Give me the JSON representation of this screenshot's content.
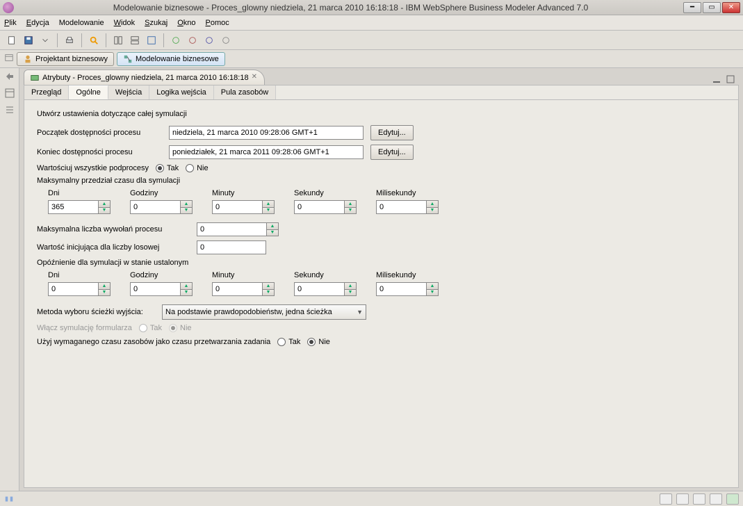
{
  "window": {
    "title": "Modelowanie biznesowe - Proces_glowny niedziela, 21 marca 2010 16:18:18 - IBM WebSphere Business Modeler Advanced 7.0"
  },
  "menu": {
    "file": "Plik",
    "edit": "Edycja",
    "modeling": "Modelowanie",
    "view": "Widok",
    "find": "Szukaj",
    "window": "Okno",
    "help": "Pomoc"
  },
  "perspectives": {
    "designer": "Projektant biznesowy",
    "modeling": "Modelowanie biznesowe"
  },
  "editor": {
    "tab_title": "Atrybuty - Proces_glowny niedziela, 21 marca 2010 16:18:18"
  },
  "subtabs": {
    "overview": "Przegląd",
    "general": "Ogólne",
    "inputs": "Wejścia",
    "inputlogic": "Logika wejścia",
    "resourcepool": "Pula zasobów"
  },
  "form": {
    "section_title": "Utwórz ustawienia dotyczące całej symulacji",
    "start_label": "Początek dostępności procesu",
    "start_value": "niedziela, 21 marca 2010 09:28:06 GMT+1",
    "end_label": "Koniec dostępności procesu",
    "end_value": "poniedziałek, 21 marca 2011 09:28:06 GMT+1",
    "edit_btn": "Edytuj...",
    "value_subprocesses": "Wartościuj wszystkie podprocesy",
    "yes": "Tak",
    "no": "Nie",
    "max_interval": "Maksymalny przedział czasu dla symulacji",
    "days": "Dni",
    "hours": "Godziny",
    "minutes": "Minuty",
    "seconds": "Sekundy",
    "ms": "Milisekundy",
    "interval1": {
      "d": "365",
      "h": "0",
      "m": "0",
      "s": "0",
      "ms": "0"
    },
    "max_calls": "Maksymalna liczba wywołań procesu",
    "max_calls_value": "0",
    "seed_label": "Wartość inicjująca dla liczby losowej",
    "seed_value": "0",
    "delay_label": "Opóźnienie dla symulacji w stanie ustalonym",
    "interval2": {
      "d": "0",
      "h": "0",
      "m": "0",
      "s": "0",
      "ms": "0"
    },
    "path_method_label": "Metoda wyboru ścieżki wyjścia:",
    "path_method_value": "Na podstawie prawdopodobieństw, jedna ścieżka",
    "form_sim_label": "Włącz symulację formularza",
    "use_resource_time_label": "Użyj wymaganego czasu zasobów jako czasu przetwarzania zadania"
  }
}
